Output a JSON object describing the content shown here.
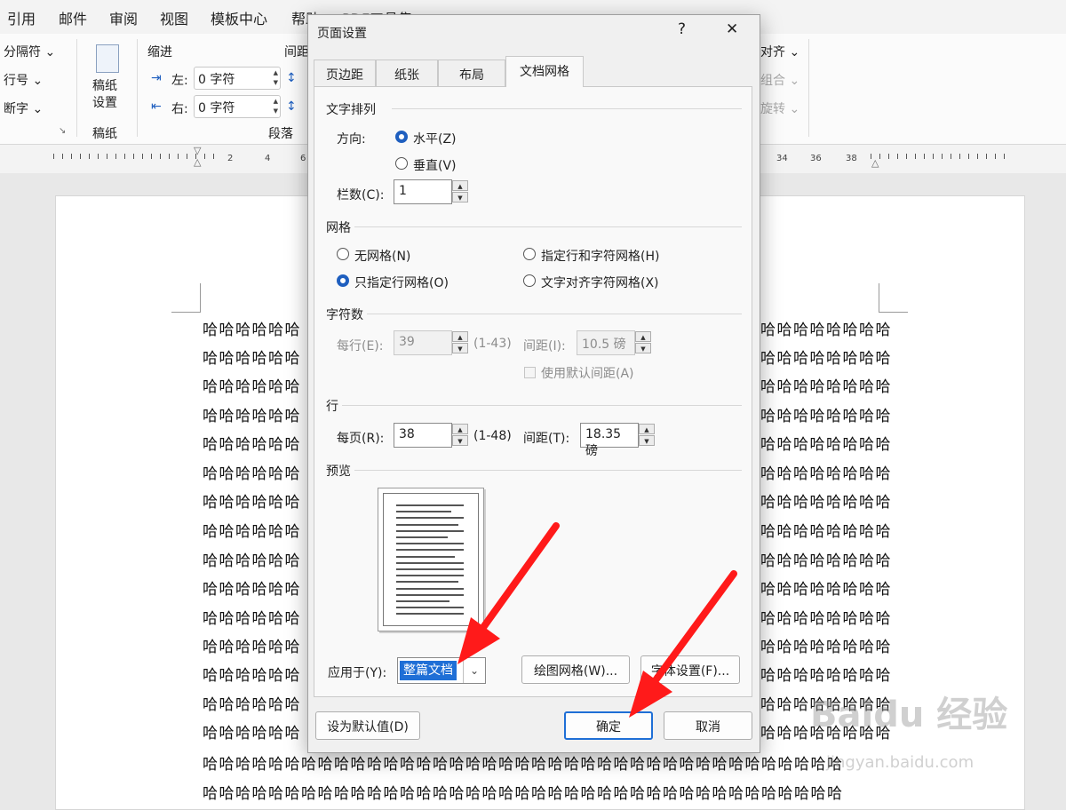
{
  "menu": {
    "items": [
      "引用",
      "邮件",
      "审阅",
      "视图",
      "模板中心",
      "帮助",
      "PDF工具集"
    ]
  },
  "ribbon": {
    "breaks_label": "分隔符",
    "line_numbers_label": "行号",
    "hyphenation_label": "断字",
    "manuscript_button": "稿纸\n设置",
    "manuscript_group": "稿纸",
    "indent_title": "缩进",
    "indent_left_label": "左:",
    "indent_left_value": "0 字符",
    "indent_right_label": "右:",
    "indent_right_value": "0 字符",
    "spacing_title": "间距",
    "paragraph_group": "段落",
    "align_label": "对齐",
    "group_label": "组合",
    "rotate_label": "旋转"
  },
  "ruler": {
    "left_numbers": [
      "2",
      "4",
      "6"
    ],
    "right_numbers": [
      "34",
      "36",
      "38"
    ]
  },
  "document": {
    "line_text": "哈哈哈哈哈哈哈哈哈哈哈哈哈哈哈哈哈哈哈哈哈哈哈哈哈哈哈哈哈哈哈哈哈哈哈哈哈哈哈",
    "left_fragment": "哈哈哈哈哈哈",
    "right_fragment": "哈哈哈哈哈哈哈哈"
  },
  "dialog": {
    "title": "页面设置",
    "help": "?",
    "close": "✕",
    "tabs": [
      "页边距",
      "纸张",
      "布局",
      "文档网格"
    ],
    "text_direction": {
      "section": "文字排列",
      "direction_label": "方向:",
      "horizontal": "水平(Z)",
      "vertical": "垂直(V)",
      "columns_label": "栏数(C):",
      "columns_value": "1"
    },
    "grid": {
      "section": "网格",
      "none": "无网格(N)",
      "lines_only": "只指定行网格(O)",
      "lines_and_chars": "指定行和字符网格(H)",
      "snap_chars": "文字对齐字符网格(X)"
    },
    "chars": {
      "section": "字符数",
      "per_line_label": "每行(E):",
      "per_line_value": "39",
      "per_line_range": "(1-43)",
      "pitch_label": "间距(I):",
      "pitch_value": "10.5 磅",
      "default_pitch": "使用默认间距(A)"
    },
    "lines": {
      "section": "行",
      "per_page_label": "每页(R):",
      "per_page_value": "38",
      "per_page_range": "(1-48)",
      "pitch_label": "间距(T):",
      "pitch_value": "18.35 磅"
    },
    "preview": {
      "section": "预览"
    },
    "apply": {
      "label": "应用于(Y):",
      "value": "整篇文档"
    },
    "buttons": {
      "drawing_grid": "绘图网格(W)...",
      "font_settings": "字体设置(F)...",
      "set_default": "设为默认值(D)",
      "ok": "确定",
      "cancel": "取消"
    }
  },
  "watermark": {
    "logo": "Baidu 经验",
    "url": "jingyan.baidu.com"
  },
  "colors": {
    "accent": "#1f6fd6",
    "arrow": "#ff1a1a"
  }
}
